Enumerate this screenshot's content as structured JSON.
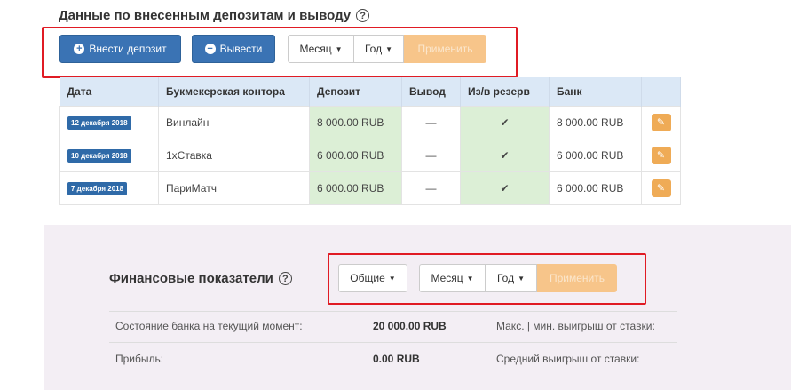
{
  "deposits_section": {
    "title": "Данные по внесенным депозитам и выводу",
    "deposit_button": "Внести депозит",
    "withdraw_button": "Вывести",
    "month_select": "Месяц",
    "year_select": "Год",
    "apply_button": "Применить",
    "table": {
      "headers": [
        "Дата",
        "Букмекерская контора",
        "Депозит",
        "Вывод",
        "Из/в резерв",
        "Банк",
        ""
      ],
      "rows": [
        {
          "date": "12 декабря 2018",
          "bookmaker": "Винлайн",
          "deposit": "8 000.00 RUB",
          "withdraw": "—",
          "bank": "8 000.00 RUB"
        },
        {
          "date": "10 декабря 2018",
          "bookmaker": "1хСтавка",
          "deposit": "6 000.00 RUB",
          "withdraw": "—",
          "bank": "6 000.00 RUB"
        },
        {
          "date": "7 декабря 2018",
          "bookmaker": "ПариМатч",
          "deposit": "6 000.00 RUB",
          "withdraw": "—",
          "bank": "6 000.00 RUB"
        }
      ]
    }
  },
  "finance_section": {
    "title": "Финансовые показатели",
    "type_select": "Общие",
    "month_select": "Месяц",
    "year_select": "Год",
    "apply_button": "Применить",
    "rows": [
      {
        "label": "Состояние банка на текущий момент:",
        "value": "20 000.00 RUB",
        "right_label": "Макс. | мин. выигрыш от ставки:"
      },
      {
        "label": "Прибыль:",
        "value": "0.00 RUB",
        "right_label": "Средний выигрыш от ставки:"
      }
    ]
  },
  "colors": {
    "primary": "#3a73b4",
    "apply": "#f7c58a",
    "highlight_box": "#e01b24",
    "green_cell": "#dcefd6",
    "header_bg": "#dbe8f6"
  }
}
